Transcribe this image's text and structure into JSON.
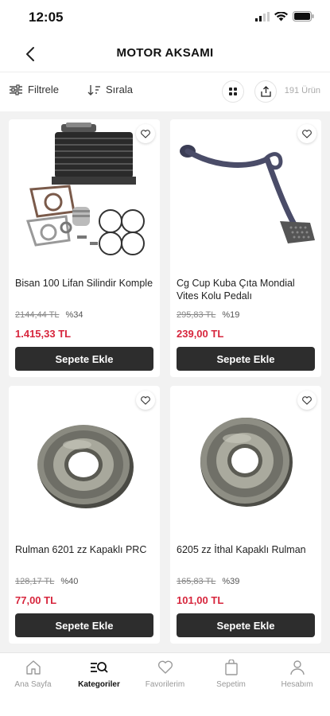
{
  "status": {
    "time": "12:05"
  },
  "header": {
    "title": "MOTOR AKSAMI"
  },
  "toolbar": {
    "filter_label": "Filtrele",
    "sort_label": "Sırala",
    "count_label": "191 Ürün"
  },
  "products": [
    {
      "name": "Bisan 100 Lifan Silindir Komple",
      "old_price": "2144,44 TL",
      "discount": "%34",
      "price": "1.415,33 TL",
      "button": "Sepete Ekle",
      "image": "cylinder-kit"
    },
    {
      "name": "Cg Cup Kuba Çıta Mondial Vites Kolu Pedalı",
      "old_price": "295,83 TL",
      "discount": "%19",
      "price": "239,00 TL",
      "button": "Sepete Ekle",
      "image": "gear-pedal"
    },
    {
      "name": "Rulman 6201 zz Kapaklı PRC",
      "old_price": "128,17 TL",
      "discount": "%40",
      "price": "77,00 TL",
      "button": "Sepete Ekle",
      "image": "bearing"
    },
    {
      "name": "6205 zz İthal Kapaklı Rulman",
      "old_price": "165,83 TL",
      "discount": "%39",
      "price": "101,00 TL",
      "button": "Sepete Ekle",
      "image": "bearing"
    }
  ],
  "bottom_nav": [
    {
      "label": "Ana Sayfa",
      "icon": "home-icon"
    },
    {
      "label": "Kategoriler",
      "icon": "categories-search-icon",
      "active": true
    },
    {
      "label": "Favorilerim",
      "icon": "heart-icon"
    },
    {
      "label": "Sepetim",
      "icon": "bag-icon"
    },
    {
      "label": "Hesabım",
      "icon": "user-icon"
    }
  ],
  "colors": {
    "accent_price": "#d7263d",
    "button_bg": "#2d2d2d",
    "background": "#f2f2f2"
  }
}
